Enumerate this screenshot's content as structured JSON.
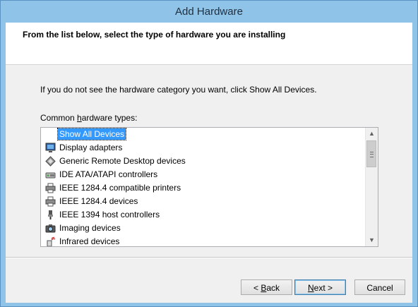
{
  "window": {
    "title": "Add Hardware"
  },
  "header": {
    "text": "From the list below, select the type of hardware you are installing"
  },
  "info_text": "If you do not see the hardware category you want, click Show All Devices.",
  "list_label": {
    "prefix": "Common ",
    "accel": "h",
    "suffix": "ardware types:"
  },
  "hardware_types": [
    {
      "label": "Show All Devices",
      "icon": "none",
      "selected": true
    },
    {
      "label": "Display adapters",
      "icon": "monitor-icon"
    },
    {
      "label": "Generic Remote Desktop devices",
      "icon": "remote-desktop-icon"
    },
    {
      "label": "IDE ATA/ATAPI controllers",
      "icon": "ide-controller-icon"
    },
    {
      "label": "IEEE 1284.4 compatible printers",
      "icon": "printer-icon"
    },
    {
      "label": "IEEE 1284.4 devices",
      "icon": "printer-icon"
    },
    {
      "label": "IEEE 1394 host controllers",
      "icon": "firewire-icon"
    },
    {
      "label": "Imaging devices",
      "icon": "camera-icon"
    },
    {
      "label": "Infrared devices",
      "icon": "infrared-icon"
    }
  ],
  "buttons": {
    "back": {
      "prefix": "< ",
      "accel": "B",
      "suffix": "ack"
    },
    "next": {
      "prefix": "",
      "accel": "N",
      "suffix": "ext >"
    },
    "cancel": "Cancel"
  },
  "colors": {
    "selection": "#3399ff",
    "frame": "#8fc3e8"
  }
}
